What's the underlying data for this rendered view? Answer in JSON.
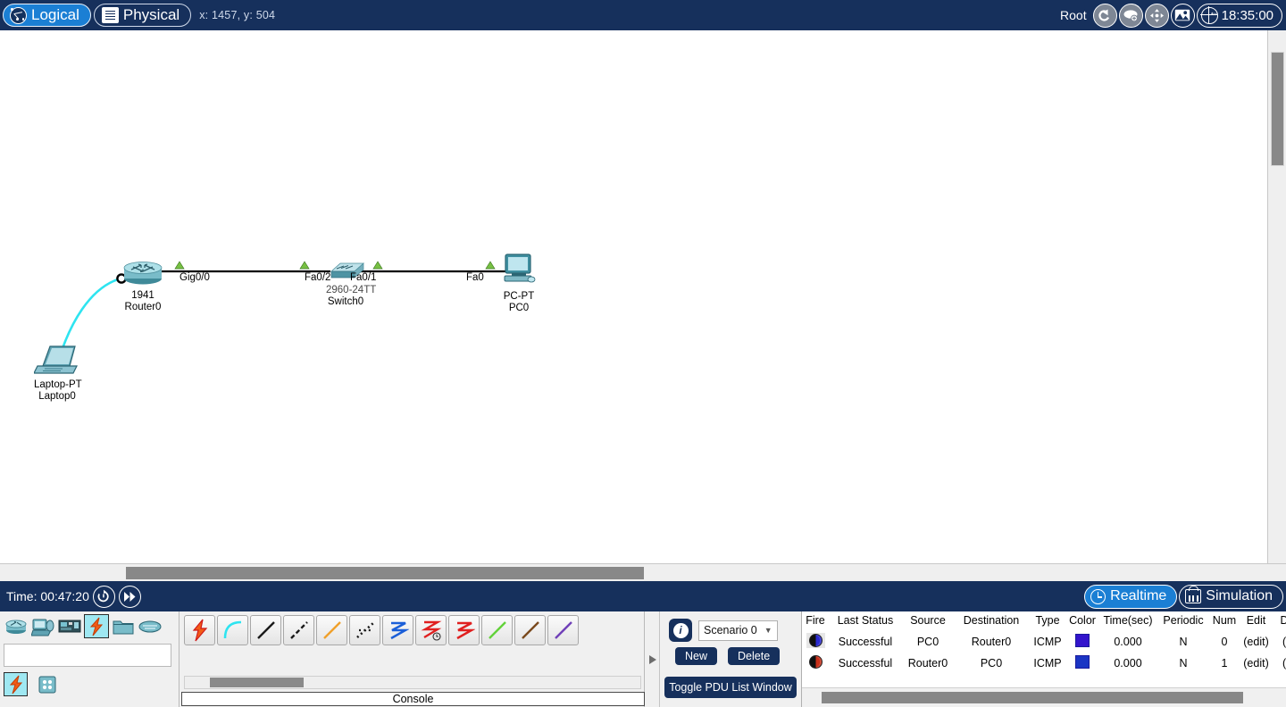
{
  "topbar": {
    "logical_tab": "Logical",
    "physical_tab": "Physical",
    "coords": "x: 1457, y: 504",
    "root_label": "Root",
    "clock": "18:35:00",
    "icons": {
      "back": "back-arrow-icon",
      "cloud": "cloud-add-icon",
      "move": "move-crosshair-icon",
      "image": "image-icon",
      "globe": "globe-icon"
    }
  },
  "workspace": {
    "devices": [
      {
        "id": "router0",
        "model": "1941",
        "name": "Router0",
        "type": "router"
      },
      {
        "id": "switch0",
        "model": "2960-24TT",
        "name": "Switch0",
        "type": "switch"
      },
      {
        "id": "pc0",
        "model": "PC-PT",
        "name": "PC0",
        "type": "pc"
      },
      {
        "id": "laptop0",
        "model": "Laptop-PT",
        "name": "Laptop0",
        "type": "laptop"
      }
    ],
    "port_labels": [
      {
        "id": "router-gig00",
        "text": "Gig0/0"
      },
      {
        "id": "switch-fa02",
        "text": "Fa0/2"
      },
      {
        "id": "switch-fa01",
        "text": "Fa0/1"
      },
      {
        "id": "pc-fa0",
        "text": "Fa0"
      }
    ],
    "links": [
      {
        "id": "router-switch",
        "kind": "copper-straight",
        "color": "#000000"
      },
      {
        "id": "switch-pc",
        "kind": "copper-straight",
        "color": "#000000"
      },
      {
        "id": "laptop-router",
        "kind": "console",
        "color": "#2ee4f0"
      }
    ]
  },
  "timebar": {
    "time_label": "Time: 00:47:20",
    "reset_icon": "reset-power-cycle-icon",
    "fast_forward_icon": "fast-forward-icon",
    "realtime_label": "Realtime",
    "simulation_label": "Simulation"
  },
  "device_palette": {
    "categories": [
      {
        "id": "network-devices",
        "icon": "router-icon",
        "selected": false
      },
      {
        "id": "end-devices",
        "icon": "end-device-icon",
        "selected": false
      },
      {
        "id": "components",
        "icon": "components-board-icon",
        "selected": false
      },
      {
        "id": "connections",
        "icon": "lightning-connections-icon",
        "selected": true
      },
      {
        "id": "miscellaneous",
        "icon": "folder-icon",
        "selected": false
      },
      {
        "id": "multiuser-connection",
        "icon": "cloud-multiuser-icon",
        "selected": false
      }
    ],
    "subcategories": [
      {
        "id": "connections-all",
        "icon": "lightning-connections-icon",
        "selected": true
      },
      {
        "id": "connections-grid",
        "icon": "grid-icon",
        "selected": false
      }
    ]
  },
  "cable_palette": {
    "cables": [
      {
        "id": "automatically-choose-connection-type",
        "icon": "lightning-icon",
        "color": "#f25c17"
      },
      {
        "id": "console",
        "icon": "console-cable-icon",
        "color": "#2ee4f0"
      },
      {
        "id": "copper-straight-through",
        "icon": "straight-cable-icon",
        "color": "#1a1a1a"
      },
      {
        "id": "copper-cross-over",
        "icon": "crossover-cable-icon",
        "color": "#1a1a1a"
      },
      {
        "id": "fiber",
        "icon": "fiber-cable-icon",
        "color": "#f0a02a"
      },
      {
        "id": "phone",
        "icon": "phone-cable-icon",
        "color": "#1a1a1a"
      },
      {
        "id": "coaxial",
        "icon": "coaxial-cable-icon",
        "color": "#1b5fd8"
      },
      {
        "id": "serial-dce",
        "icon": "serial-dce-cable-icon",
        "color": "#e02020"
      },
      {
        "id": "serial-dte",
        "icon": "serial-dte-cable-icon",
        "color": "#e02020"
      },
      {
        "id": "octal",
        "icon": "octal-cable-icon",
        "color": "#62d23a"
      },
      {
        "id": "iot-custom-cable",
        "icon": "iot-cable-icon",
        "color": "#7a4a1e"
      },
      {
        "id": "usb",
        "icon": "usb-cable-icon",
        "color": "#7040b8"
      }
    ],
    "console_label": "Console"
  },
  "scenario_panel": {
    "info_icon": "info-icon",
    "scenario_value": "Scenario 0",
    "new_label": "New",
    "delete_label": "Delete",
    "toggle_label": "Toggle PDU List Window"
  },
  "pdu_table": {
    "columns": [
      "Fire",
      "Last Status",
      "Source",
      "Destination",
      "Type",
      "Color",
      "Time(sec)",
      "Periodic",
      "Num",
      "Edit",
      "Delete"
    ],
    "column_display": [
      "Fire",
      "Last Status",
      "Source",
      "Destination",
      "Type",
      "Color",
      "Time(sec)",
      "Periodic",
      "Num",
      "Edit",
      "De"
    ],
    "rows": [
      {
        "fire": "fire-button-icon",
        "last_status": "Successful",
        "source": "PC0",
        "destination": "Router0",
        "type": "ICMP",
        "color": "#3314cc",
        "time_sec": "0.000",
        "periodic": "N",
        "num": "0",
        "edit": "(edit)",
        "delete": "(d"
      },
      {
        "fire": "fire-button-icon",
        "last_status": "Successful",
        "source": "Router0",
        "destination": "PC0",
        "type": "ICMP",
        "color": "#1b35c4",
        "time_sec": "0.000",
        "periodic": "N",
        "num": "1",
        "edit": "(edit)",
        "delete": "(d"
      }
    ]
  }
}
